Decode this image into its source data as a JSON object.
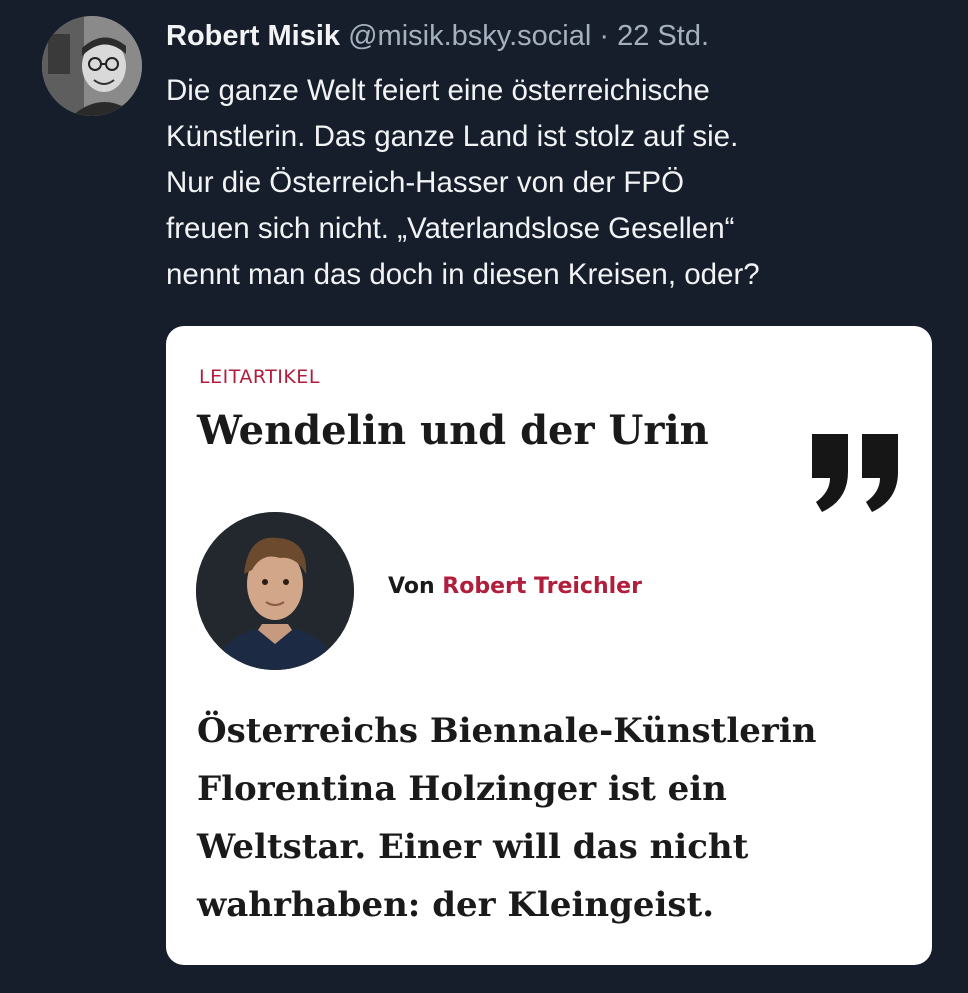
{
  "post": {
    "author_name": "Robert Misik",
    "author_handle": "@misik.bsky.social",
    "separator": "·",
    "timestamp": "22 Std.",
    "text_lines": [
      "Die ganze Welt feiert eine österreichische",
      "Künstlerin. Das ganze Land ist stolz auf sie.",
      "Nur die Österreich-Hasser von der FPÖ",
      "freuen sich nicht. „Vaterlandslose Gesellen“",
      "nennt man das doch in diesen Kreisen, oder?"
    ]
  },
  "card": {
    "kicker": "LEITARTIKEL",
    "headline": "Wendelin und der Urin",
    "quote_icon": "closing-quote-icon",
    "byline_prefix": "Von",
    "byline_author": "Robert Treichler",
    "teaser_lines": [
      "Österreichs Biennale-Künstlerin",
      "Florentina Holzinger ist ein",
      "Weltstar. Einer will das nicht",
      "wahrhaben: der Kleingeist."
    ]
  },
  "colors": {
    "background": "#161e2b",
    "accent": "#b01e3c",
    "card": "#ffffff",
    "secondary_text": "#a5b0bf"
  }
}
